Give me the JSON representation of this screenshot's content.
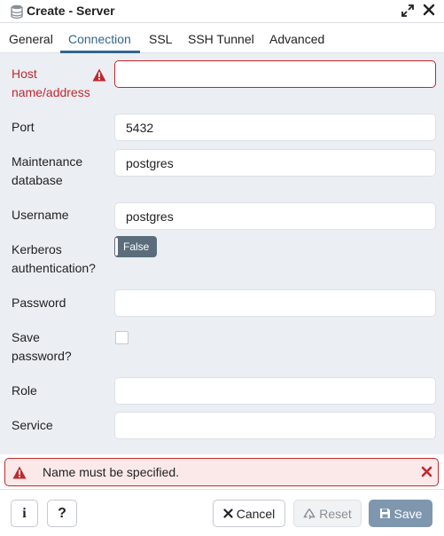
{
  "window": {
    "title": "Create - Server",
    "title_icon": "database-server-icon",
    "controls": [
      "expand-icon",
      "close-icon"
    ]
  },
  "tabs": [
    {
      "label": "General",
      "active": false
    },
    {
      "label": "Connection",
      "active": true
    },
    {
      "label": "SSL",
      "active": false
    },
    {
      "label": "SSH Tunnel",
      "active": false
    },
    {
      "label": "Advanced",
      "active": false
    }
  ],
  "form": {
    "host": {
      "label": "Host name/address",
      "value": "",
      "state": "error"
    },
    "port": {
      "label": "Port",
      "value": "5432"
    },
    "maintenance_db": {
      "label": "Maintenance database",
      "value": "postgres"
    },
    "username": {
      "label": "Username",
      "value": "postgres"
    },
    "kerberos": {
      "label": "Kerberos authentication?",
      "value": "False"
    },
    "password": {
      "label": "Password",
      "value": ""
    },
    "save_password": {
      "label": "Save password?",
      "checked": false
    },
    "role": {
      "label": "Role",
      "value": ""
    },
    "service": {
      "label": "Service",
      "value": ""
    }
  },
  "alert": {
    "message": "Name must be specified.",
    "type": "error"
  },
  "footer": {
    "info_label": "i",
    "help_label": "?",
    "cancel_label": "Cancel",
    "reset_label": "Reset",
    "save_label": "Save"
  },
  "colors": {
    "accent": "#326690",
    "error": "#c0282d",
    "form_bg": "#ebeef3",
    "toggle_bg": "#5b6d7c",
    "save_bg": "#7e97ae"
  }
}
